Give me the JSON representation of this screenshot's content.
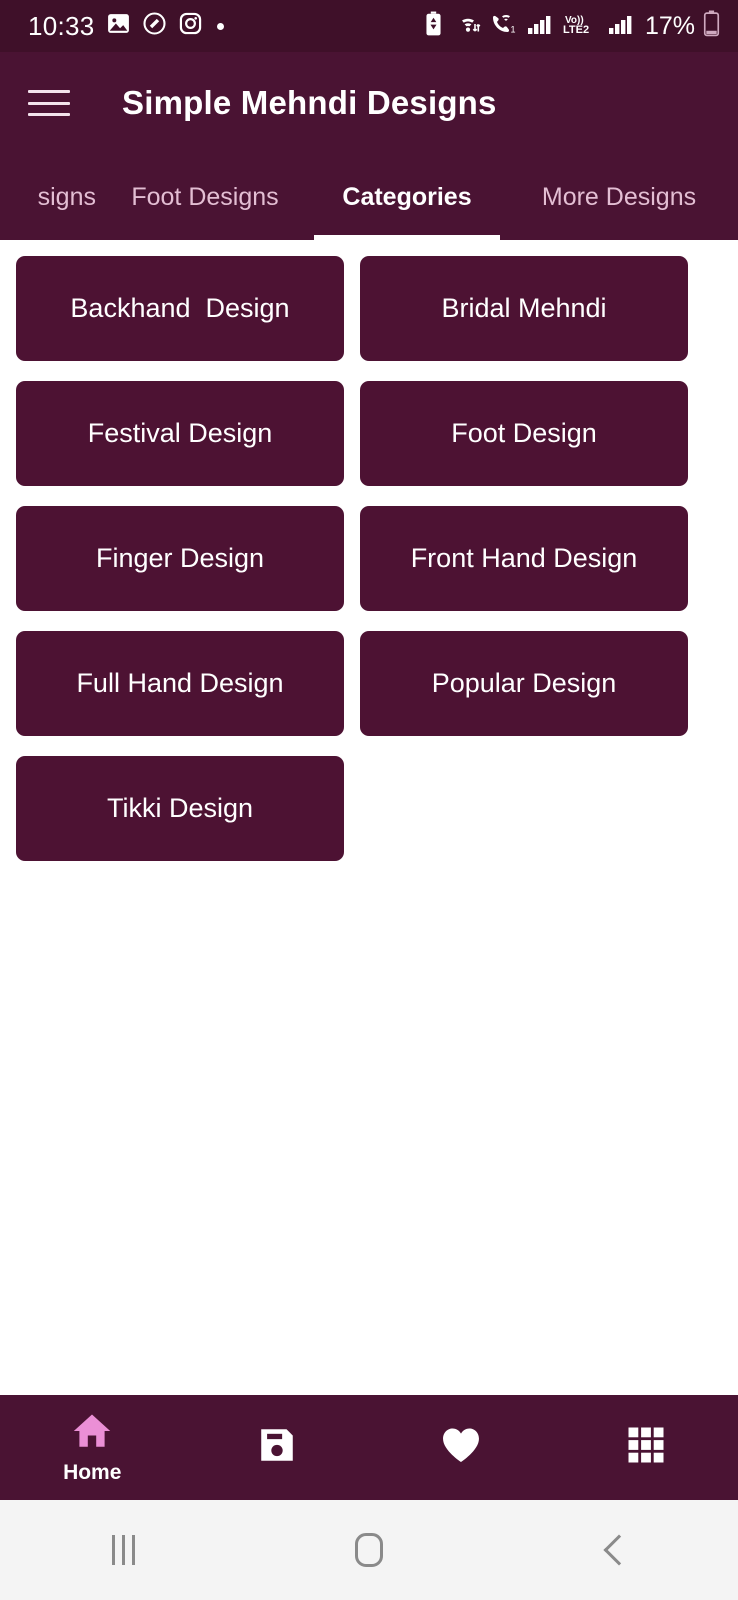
{
  "status_bar": {
    "clock": "10:33",
    "battery_percent": "17%",
    "volte_label": "LTE2",
    "volte_top": "Vo))",
    "call_badge": "1",
    "left_icons": [
      "image-gallery-icon",
      "shutterstock-icon",
      "instagram-icon",
      "notification-dot-icon"
    ],
    "right_icons": [
      "battery-saver-icon",
      "wifi-icon",
      "vowifi-call-icon",
      "signal-bars-icon",
      "volte-icon",
      "signal-bars-2-icon",
      "battery-icon"
    ]
  },
  "app_bar": {
    "menu_icon": "hamburger-menu-icon",
    "title": "Simple Mehndi Designs"
  },
  "tabs": {
    "active_index": 2,
    "items": [
      {
        "label": "signs",
        "partial": true
      },
      {
        "label": "Foot Designs",
        "partial": false
      },
      {
        "label": "Categories",
        "partial": false
      },
      {
        "label": "More Designs",
        "partial": false
      }
    ]
  },
  "categories": {
    "items": [
      {
        "label": "Backhand  Design"
      },
      {
        "label": "Bridal Mehndi"
      },
      {
        "label": "Festival Design"
      },
      {
        "label": "Foot Design"
      },
      {
        "label": "Finger Design"
      },
      {
        "label": "Front Hand Design"
      },
      {
        "label": "Full Hand Design"
      },
      {
        "label": "Popular Design"
      },
      {
        "label": "Tikki Design"
      }
    ]
  },
  "bottom_nav": {
    "items": [
      {
        "icon": "home-icon",
        "label": "Home",
        "active": true
      },
      {
        "icon": "save-floppy-icon",
        "label": "",
        "active": false
      },
      {
        "icon": "heart-icon",
        "label": "",
        "active": false
      },
      {
        "icon": "grid-apps-icon",
        "label": "",
        "active": false
      }
    ]
  },
  "android_nav": {
    "items": [
      "recents-icon",
      "home-icon",
      "back-icon"
    ]
  },
  "colors": {
    "status_bar_bg": "#3f1029",
    "app_bar_bg": "#4a1333",
    "button_bg": "#4d1233",
    "accent_pink": "#eb8fd6",
    "tab_inactive": "#e3bed3",
    "content_bg": "#ffffff",
    "android_nav_bg": "#f4f4f4"
  }
}
